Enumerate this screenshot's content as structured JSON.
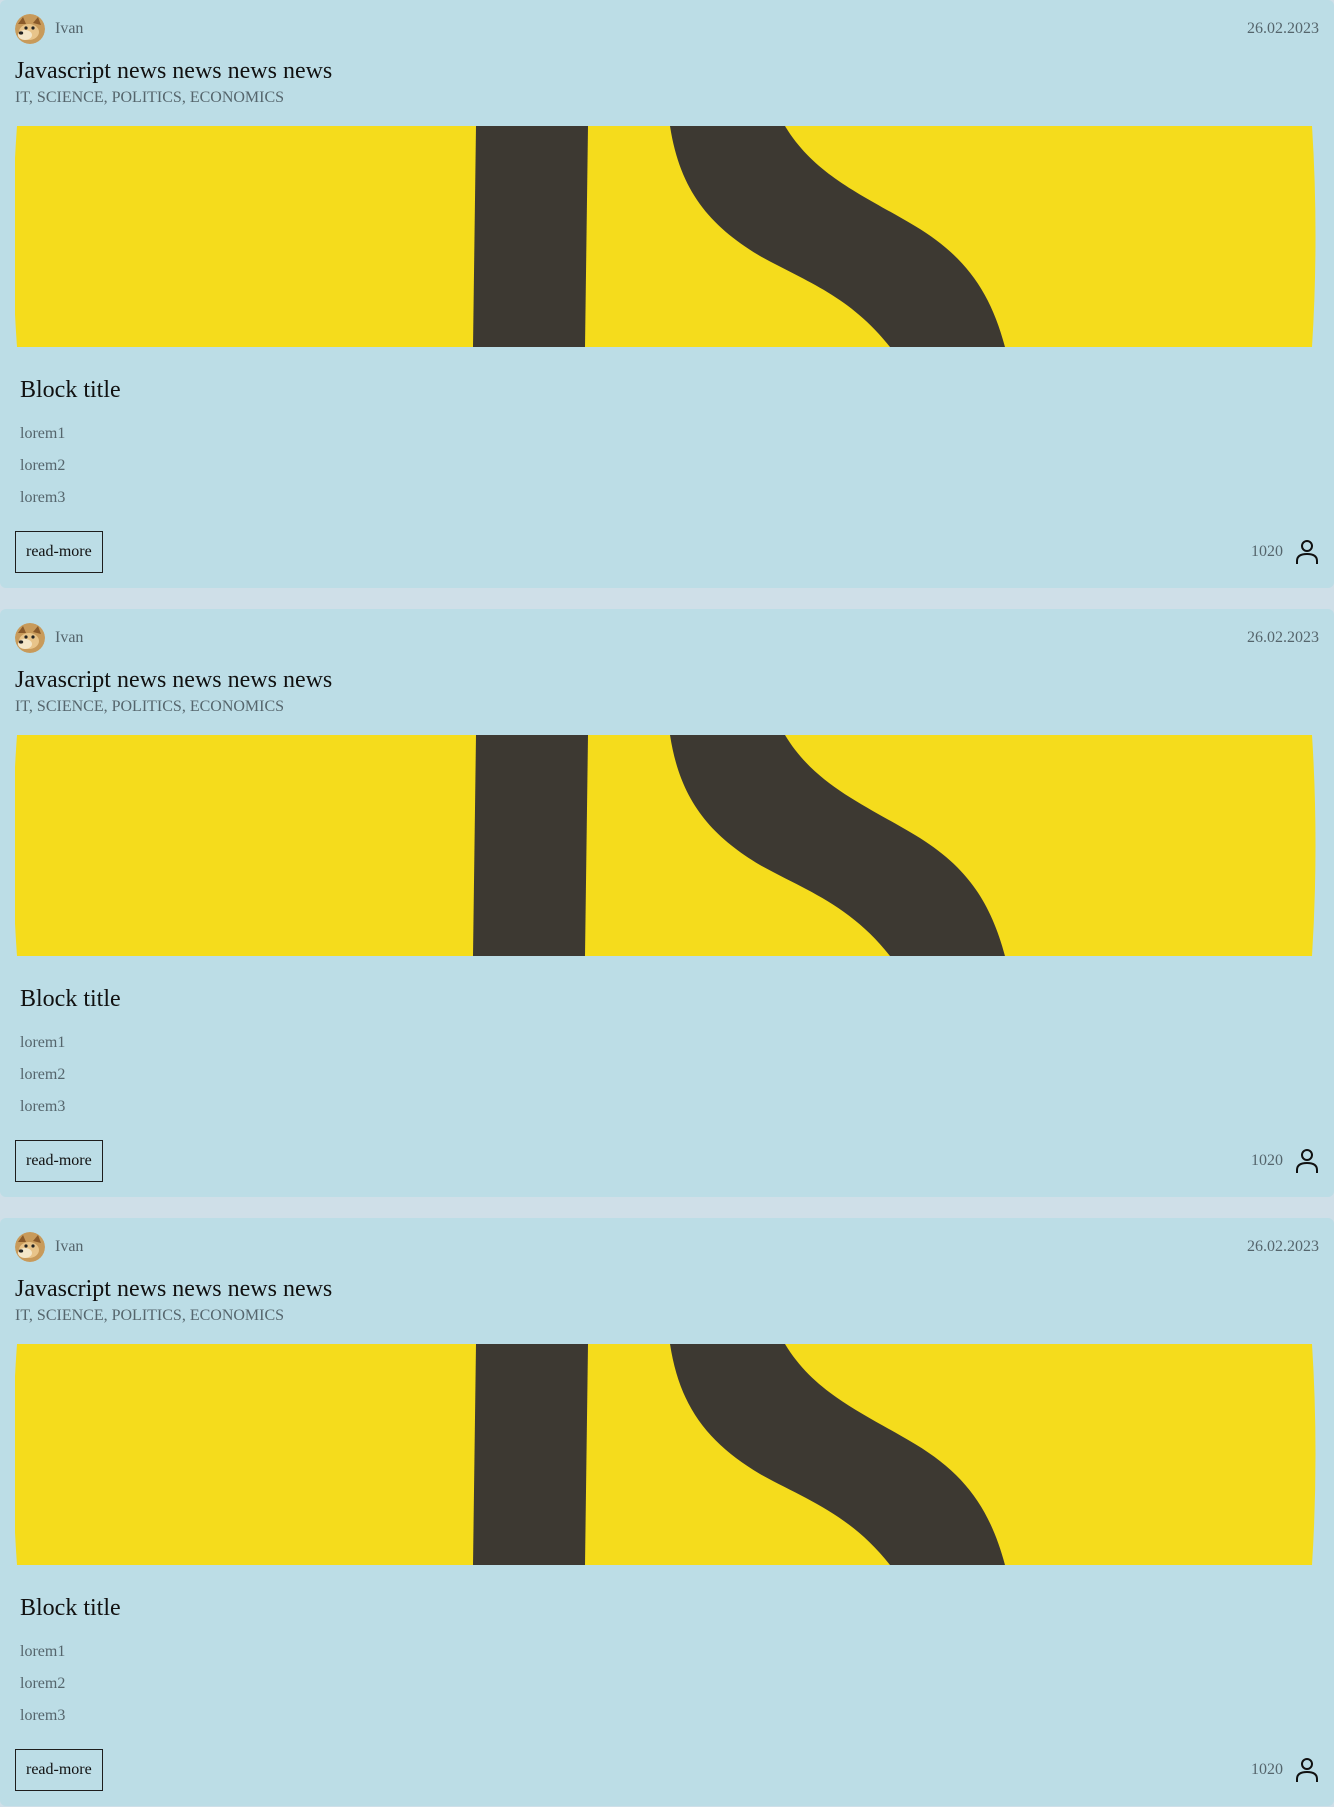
{
  "posts": [
    {
      "author": "Ivan",
      "date": "26.02.2023",
      "title": "Javascript news news news news",
      "tags": "IT, SCIENCE, POLITICS, ECONOMICS",
      "block_title": "Block title",
      "items": [
        "lorem1",
        "lorem2",
        "lorem3"
      ],
      "read_more_label": "read-more",
      "views": "1020"
    },
    {
      "author": "Ivan",
      "date": "26.02.2023",
      "title": "Javascript news news news news",
      "tags": "IT, SCIENCE, POLITICS, ECONOMICS",
      "block_title": "Block title",
      "items": [
        "lorem1",
        "lorem2",
        "lorem3"
      ],
      "read_more_label": "read-more",
      "views": "1020"
    },
    {
      "author": "Ivan",
      "date": "26.02.2023",
      "title": "Javascript news news news news",
      "tags": "IT, SCIENCE, POLITICS, ECONOMICS",
      "block_title": "Block title",
      "items": [
        "lorem1",
        "lorem2",
        "lorem3"
      ],
      "read_more_label": "read-more",
      "views": "1020"
    }
  ],
  "icons": {
    "avatar": "doge-avatar",
    "views": "user-icon"
  },
  "colors": {
    "card_background": "#bcdde6",
    "page_background": "#cfdfe8",
    "image_yellow": "#f5dc1c",
    "image_dark": "#3d3932"
  }
}
